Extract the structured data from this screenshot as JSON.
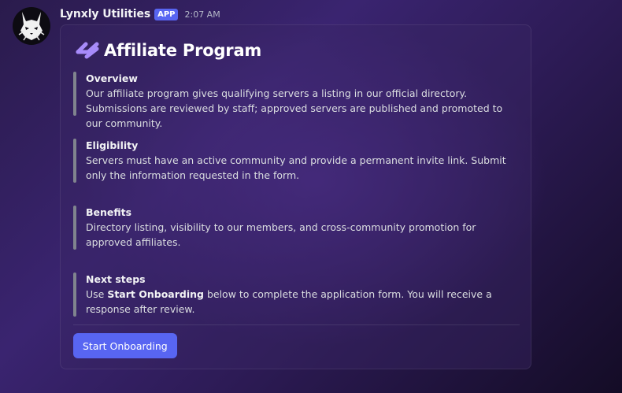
{
  "message": {
    "username": "Lynxly Utilities",
    "badge": "APP",
    "timestamp": "2:07 AM",
    "avatar_icon": "lynx-icon"
  },
  "embed": {
    "title": "Affiliate Program",
    "title_icon": "link-icon",
    "accent_color": "#a78bfa",
    "sections": [
      {
        "heading": "Overview",
        "body": "Our affiliate program gives qualifying servers a listing in our official directory. Submissions are reviewed by staff; approved servers are published and promoted to our community."
      },
      {
        "heading": "Eligibility",
        "body": "Servers must have an active community and provide a permanent invite link. Submit only the information requested in the form."
      },
      {
        "heading": "Benefits",
        "body": "Directory listing, visibility to our members, and cross-community promotion for approved affiliates."
      },
      {
        "heading": "Next steps",
        "body_prefix": "Use ",
        "body_bold": "Start Onboarding",
        "body_suffix": " below to complete the application form. You will receive a response after review."
      }
    ],
    "button_label": "Start Onboarding",
    "button_color": "#5865f2"
  }
}
